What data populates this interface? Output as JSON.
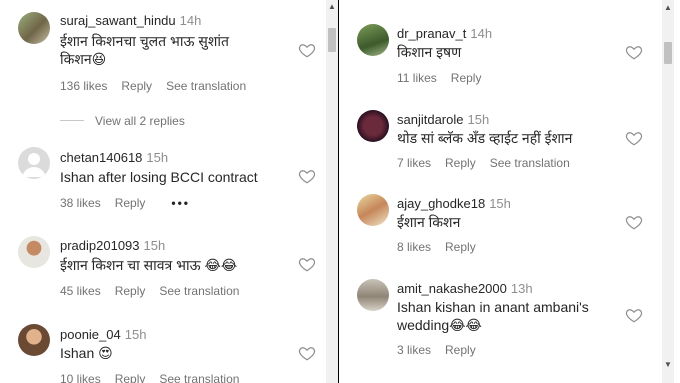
{
  "left_comments": [
    {
      "username": "suraj_sawant_hindu",
      "time": "14h",
      "lines": [
        "ईशान किशनचा चुलत भाऊ सुशांत",
        "किशन😆"
      ],
      "likes": "136 likes",
      "reply": "Reply",
      "see_translation": "See translation"
    },
    {
      "view_replies": "View all 2 replies"
    },
    {
      "username": "chetan140618",
      "time": "15h",
      "lines": [
        "Ishan after losing BCCI contract"
      ],
      "likes": "38 likes",
      "reply": "Reply",
      "more": "•••"
    },
    {
      "username": "pradip201093",
      "time": "15h",
      "lines": [
        "ईशान किशन चा सावत्र भाऊ 😂😂"
      ],
      "likes": "45 likes",
      "reply": "Reply",
      "see_translation": "See translation"
    },
    {
      "username": "poonie_04",
      "time": "15h",
      "lines": [
        "Ishan 😍"
      ],
      "likes": "10 likes",
      "reply": "Reply",
      "see_translation": "See translation"
    }
  ],
  "right_comments": [
    {
      "username": "dr_pranav_t",
      "time": "14h",
      "lines": [
        "किशान इषण"
      ],
      "likes": "11 likes",
      "reply": "Reply"
    },
    {
      "username": "sanjitdarole",
      "time": "15h",
      "lines": [
        "थोड सां ब्लॅक अँड व्हाईट नहीं ईशान"
      ],
      "likes": "7 likes",
      "reply": "Reply",
      "see_translation": "See translation"
    },
    {
      "username": "ajay_ghodke18",
      "time": "15h",
      "lines": [
        "ईशान किशन"
      ],
      "likes": "8 likes",
      "reply": "Reply"
    },
    {
      "username": "amit_nakashe2000",
      "time": "13h",
      "lines": [
        "Ishan kishan in anant ambani's",
        "wedding😂😂"
      ],
      "likes": "3 likes",
      "reply": "Reply"
    }
  ],
  "icons": {
    "like": "heart-outline-icon",
    "scroll_up": "chevron-up-icon",
    "scroll_down": "chevron-down-icon"
  },
  "colors": {
    "text": "#262626",
    "muted": "#737373",
    "heart": "#8e8e8e"
  }
}
